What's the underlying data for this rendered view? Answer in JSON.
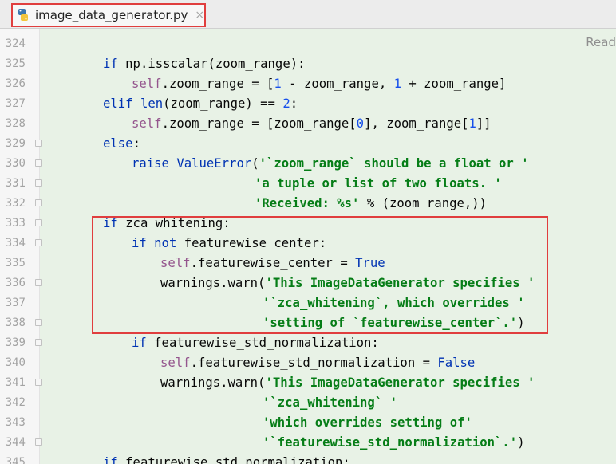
{
  "tab": {
    "filename": "image_data_generator.py",
    "close_glyph": "×",
    "icon": "python-file-icon"
  },
  "reader_mode_label": "Read",
  "colors": {
    "keyword": "#0033b3",
    "string": "#067d17",
    "number": "#1750eb",
    "self": "#94558d",
    "highlight_border": "#e03e3e",
    "background": "#e8f2e6"
  },
  "lines": [
    {
      "num": "324",
      "indent": 2,
      "fold": false,
      "tokens": [
        {
          "t": "",
          "c": ""
        }
      ]
    },
    {
      "num": "325",
      "indent": 2,
      "fold": false,
      "tokens": [
        {
          "t": "if",
          "c": "kw"
        },
        {
          "t": " np.isscalar(zoom_range):",
          "c": ""
        }
      ]
    },
    {
      "num": "326",
      "indent": 3,
      "fold": false,
      "tokens": [
        {
          "t": "self",
          "c": "self"
        },
        {
          "t": ".zoom_range = [",
          "c": ""
        },
        {
          "t": "1",
          "c": "num"
        },
        {
          "t": " - zoom_range, ",
          "c": ""
        },
        {
          "t": "1",
          "c": "num"
        },
        {
          "t": " + zoom_range]",
          "c": ""
        }
      ]
    },
    {
      "num": "327",
      "indent": 2,
      "fold": false,
      "tokens": [
        {
          "t": "elif",
          "c": "kw"
        },
        {
          "t": " ",
          "c": ""
        },
        {
          "t": "len",
          "c": "kw"
        },
        {
          "t": "(zoom_range) == ",
          "c": ""
        },
        {
          "t": "2",
          "c": "num"
        },
        {
          "t": ":",
          "c": ""
        }
      ]
    },
    {
      "num": "328",
      "indent": 3,
      "fold": false,
      "tokens": [
        {
          "t": "self",
          "c": "self"
        },
        {
          "t": ".zoom_range = [zoom_range[",
          "c": ""
        },
        {
          "t": "0",
          "c": "num"
        },
        {
          "t": "], zoom_range[",
          "c": ""
        },
        {
          "t": "1",
          "c": "num"
        },
        {
          "t": "]]",
          "c": ""
        }
      ]
    },
    {
      "num": "329",
      "indent": 2,
      "fold": true,
      "tokens": [
        {
          "t": "else",
          "c": "kw"
        },
        {
          "t": ":",
          "c": ""
        }
      ]
    },
    {
      "num": "330",
      "indent": 3,
      "fold": true,
      "tokens": [
        {
          "t": "raise",
          "c": "kw"
        },
        {
          "t": " ",
          "c": ""
        },
        {
          "t": "ValueError",
          "c": "kw"
        },
        {
          "t": "(",
          "c": ""
        },
        {
          "t": "'`zoom_range` should be a float or '",
          "c": "str"
        }
      ]
    },
    {
      "num": "331",
      "indent": 0,
      "col": 319,
      "fold": true,
      "tokens": [
        {
          "t": "'a tuple or list of two floats. '",
          "c": "str"
        }
      ]
    },
    {
      "num": "332",
      "indent": 0,
      "col": 319,
      "fold": true,
      "tokens": [
        {
          "t": "'Received: %s'",
          "c": "str"
        },
        {
          "t": " % (zoom_range,))",
          "c": ""
        }
      ]
    },
    {
      "num": "333",
      "indent": 2,
      "fold": true,
      "tokens": [
        {
          "t": "if",
          "c": "kw"
        },
        {
          "t": " zca_whitening:",
          "c": ""
        }
      ]
    },
    {
      "num": "334",
      "indent": 3,
      "fold": true,
      "tokens": [
        {
          "t": "if not",
          "c": "kw"
        },
        {
          "t": " featurewise_center:",
          "c": ""
        }
      ]
    },
    {
      "num": "335",
      "indent": 4,
      "fold": false,
      "tokens": [
        {
          "t": "self",
          "c": "self"
        },
        {
          "t": ".featurewise_center = ",
          "c": ""
        },
        {
          "t": "True",
          "c": "kw"
        }
      ]
    },
    {
      "num": "336",
      "indent": 4,
      "fold": true,
      "tokens": [
        {
          "t": "warnings.warn(",
          "c": ""
        },
        {
          "t": "'This ImageDataGenerator specifies '",
          "c": "str"
        }
      ]
    },
    {
      "num": "337",
      "indent": 0,
      "col": 329,
      "fold": false,
      "tokens": [
        {
          "t": "'`zca_whitening`, which overrides '",
          "c": "str"
        }
      ]
    },
    {
      "num": "338",
      "indent": 0,
      "col": 329,
      "fold": true,
      "tokens": [
        {
          "t": "'setting of `featurewise_center`.'",
          "c": "str"
        },
        {
          "t": ")",
          "c": ""
        }
      ]
    },
    {
      "num": "339",
      "indent": 3,
      "fold": true,
      "tokens": [
        {
          "t": "if",
          "c": "kw"
        },
        {
          "t": " featurewise_std_normalization:",
          "c": ""
        }
      ]
    },
    {
      "num": "340",
      "indent": 4,
      "fold": false,
      "tokens": [
        {
          "t": "self",
          "c": "self"
        },
        {
          "t": ".featurewise_std_normalization = ",
          "c": ""
        },
        {
          "t": "False",
          "c": "kw"
        }
      ]
    },
    {
      "num": "341",
      "indent": 4,
      "fold": true,
      "tokens": [
        {
          "t": "warnings.warn(",
          "c": ""
        },
        {
          "t": "'This ImageDataGenerator specifies '",
          "c": "str"
        }
      ]
    },
    {
      "num": "342",
      "indent": 0,
      "col": 329,
      "fold": false,
      "tokens": [
        {
          "t": "'`zca_whitening` '",
          "c": "str"
        }
      ]
    },
    {
      "num": "343",
      "indent": 0,
      "col": 329,
      "fold": false,
      "tokens": [
        {
          "t": "'which overrides setting of'",
          "c": "str"
        }
      ]
    },
    {
      "num": "344",
      "indent": 0,
      "col": 329,
      "fold": true,
      "tokens": [
        {
          "t": "'`featurewise_std_normalization`.'",
          "c": "str"
        },
        {
          "t": ")",
          "c": ""
        }
      ]
    },
    {
      "num": "345",
      "indent": 2,
      "fold": false,
      "tokens": [
        {
          "t": "if",
          "c": "kw"
        },
        {
          "t": " featurewise_std_normalization:",
          "c": ""
        }
      ]
    }
  ]
}
